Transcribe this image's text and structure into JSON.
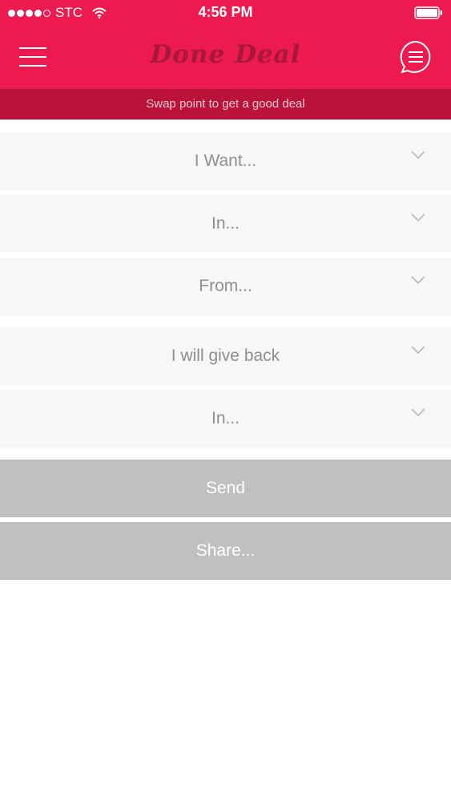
{
  "status_bar": {
    "carrier": "STC",
    "time": "4:56 PM",
    "signal_dots_filled": 4,
    "signal_dots_total": 5
  },
  "navbar": {
    "logo_text": "Done Deal",
    "menu_icon": "hamburger-menu-icon",
    "chat_icon": "chat-bubble-menu-icon"
  },
  "subheader": {
    "text": "Swap point to get a good deal"
  },
  "form": {
    "fields": [
      {
        "label": "I Want..."
      },
      {
        "label": "In..."
      },
      {
        "label": "From..."
      },
      {
        "label": "I will give back"
      },
      {
        "label": "In..."
      }
    ]
  },
  "actions": {
    "send_label": "Send",
    "share_label": "Share..."
  },
  "colors": {
    "header": "#ec1a4e",
    "subheader": "#ba1238",
    "logo": "#a8173c",
    "field_bg": "#f7f7f8",
    "field_text": "#8e8e93",
    "button_bg": "#c0bfc2"
  }
}
